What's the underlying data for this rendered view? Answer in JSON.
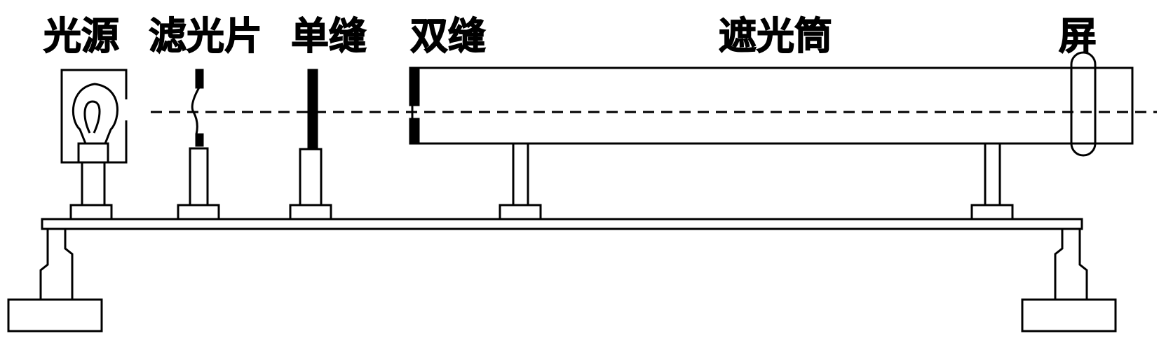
{
  "labels": {
    "light_source": "光源",
    "filter": "滤光片",
    "single_slit": "单缝",
    "double_slit": "双缝",
    "hood": "遮光筒",
    "screen": "屏"
  },
  "colors": {
    "ink": "#000000",
    "paper": "#ffffff"
  }
}
